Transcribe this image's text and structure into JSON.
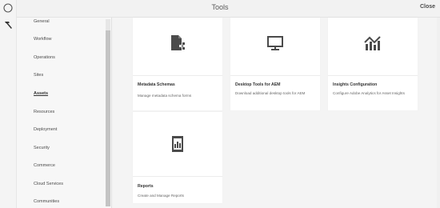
{
  "header": {
    "title": "Tools",
    "close_label": "Close"
  },
  "rail": {
    "icons": [
      "compass-icon",
      "hammer-icon"
    ]
  },
  "sidebar": {
    "items": [
      {
        "label": "General"
      },
      {
        "label": "Workflow"
      },
      {
        "label": "Operations"
      },
      {
        "label": "Sites"
      },
      {
        "label": "Assets",
        "active": true
      },
      {
        "label": "Resources"
      },
      {
        "label": "Deployment"
      },
      {
        "label": "Security"
      },
      {
        "label": "Commerce"
      },
      {
        "label": "Cloud Services"
      },
      {
        "label": "Communities"
      }
    ]
  },
  "cards": [
    {
      "title": "Metadata Schemas",
      "description": "Manage metadata schema forms",
      "icon": "schema-document-icon"
    },
    {
      "title": "Desktop Tools for AEM",
      "description": "Download additional desktop tools for AEM",
      "icon": "monitor-icon"
    },
    {
      "title": "Insights Configuration",
      "description": "Configure Adobe Analytics for Asset Insights",
      "icon": "chart-insights-icon"
    },
    {
      "title": "Reports",
      "description": "Create and Manage Reports",
      "icon": "report-document-icon"
    }
  ],
  "colors": {
    "background": "#f4f4f4",
    "card": "#ffffff",
    "icon": "#4b4b4b"
  }
}
